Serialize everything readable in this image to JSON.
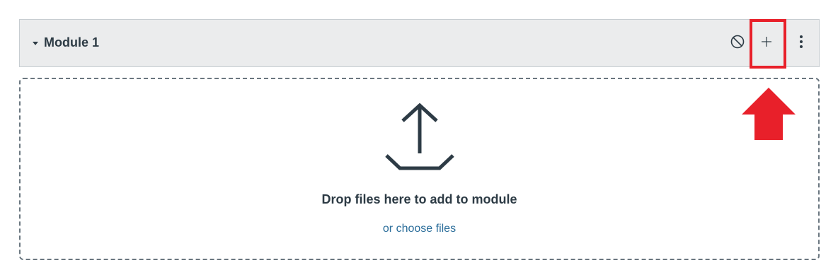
{
  "module": {
    "title": "Module 1",
    "collapse_icon": "caret-down-icon",
    "actions": [
      {
        "name": "publish",
        "icon": "unpublished-icon"
      },
      {
        "name": "add",
        "icon": "plus-icon"
      },
      {
        "name": "more",
        "icon": "kebab-icon"
      }
    ]
  },
  "dropzone": {
    "icon": "upload-icon",
    "message": "Drop files here to add to module",
    "link": "or choose files"
  },
  "annotation": {
    "highlight_color": "#e8202a",
    "arrow_icon": "arrow-up-icon"
  },
  "colors": {
    "header_bg": "#ebeced",
    "text": "#2d3b45",
    "link": "#2a6d9a"
  }
}
